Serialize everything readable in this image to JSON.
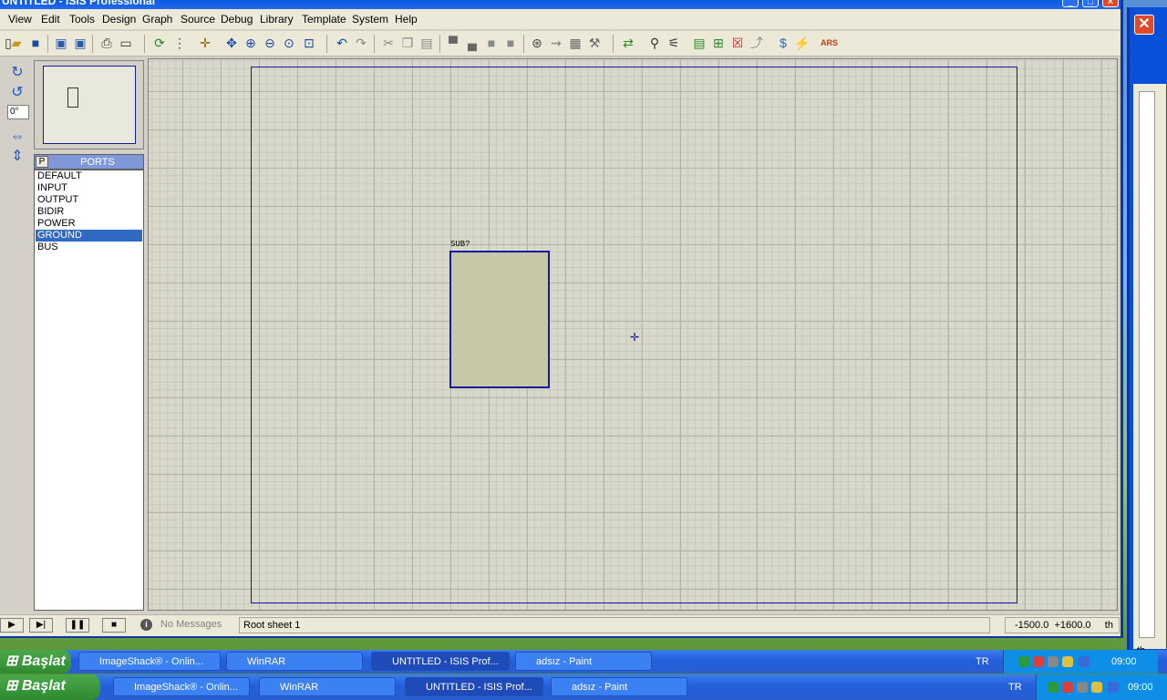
{
  "window": {
    "title": "UNTITLED - ISIS Professional"
  },
  "menu": [
    "View",
    "Edit",
    "Tools",
    "Design",
    "Graph",
    "Source",
    "Debug",
    "Library",
    "Template",
    "System",
    "Help"
  ],
  "left_panel": {
    "angle": "0°",
    "ports_p": "P",
    "ports_title": "PORTS",
    "ports": [
      "DEFAULT",
      "INPUT",
      "OUTPUT",
      "BIDIR",
      "POWER",
      "GROUND",
      "BUS"
    ],
    "selected_port": "GROUND"
  },
  "canvas": {
    "component_label": "SUB?"
  },
  "status": {
    "messages": "No Messages",
    "sheet": "Root sheet 1",
    "x": "-1500.0",
    "y": "+1600.0",
    "unit": "th"
  },
  "background_window": {
    "unit": "th"
  },
  "taskbar_top": {
    "start": "Başlat",
    "tasks": [
      "ImageShack® - Onlin...",
      "WinRAR",
      "UNTITLED - ISIS Prof...",
      "adsız - Paint"
    ],
    "lang": "TR",
    "time": "09:00"
  },
  "taskbar_bottom": {
    "start": "Başlat",
    "tasks": [
      "ImageShack® - Onlin...",
      "WinRAR",
      "UNTITLED - ISIS Prof...",
      "adsız - Paint"
    ],
    "lang": "TR",
    "time": "09:00"
  }
}
